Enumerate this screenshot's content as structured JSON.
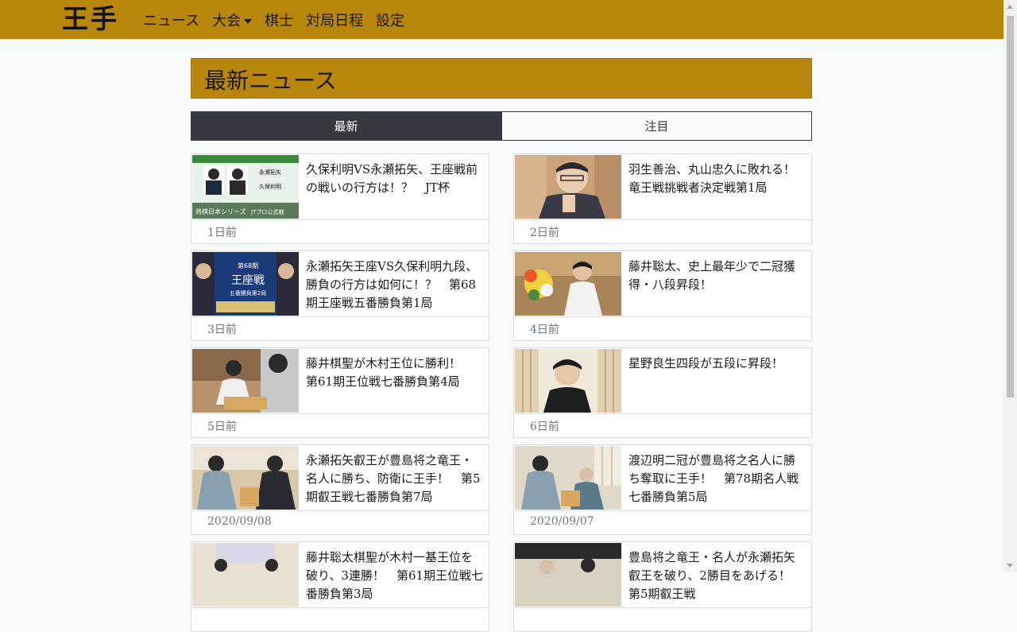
{
  "nav": {
    "logo": "王手",
    "links": [
      "ニュース",
      "大会",
      "棋士",
      "対局日程",
      "設定"
    ]
  },
  "header": {
    "title": "最新ニュース"
  },
  "tabs": [
    {
      "label": "最新",
      "active": true
    },
    {
      "label": "注目",
      "active": false
    }
  ],
  "news": [
    {
      "title": "久保利明VS永瀬拓矢、王座戦前の戦いの行方は！？　JT杯",
      "date": "1日前",
      "thumb_text": [
        "永瀬拓矢",
        "久保利明",
        "将棋日本シリーズ",
        "JTプロ公式戦"
      ]
    },
    {
      "title": "羽生善治、丸山忠久に敗れる！　竜王戦挑戦者決定戦第1局",
      "date": "2日前"
    },
    {
      "title": "永瀬拓矢王座VS久保利明九段、勝負の行方は如何に！？　第68期王座戦五番勝負第1局",
      "date": "3日前",
      "thumb_text": [
        "第68期",
        "王座戦",
        "五番勝負第2局"
      ]
    },
    {
      "title": "藤井聡太、史上最年少で二冠獲得・八段昇段！",
      "date": "4日前"
    },
    {
      "title": "藤井棋聖が木村王位に勝利！　第61期王位戦七番勝負第4局",
      "date": "5日前"
    },
    {
      "title": "星野良生四段が五段に昇段！",
      "date": "6日前"
    },
    {
      "title": "永瀬拓矢叡王が豊島将之竜王・名人に勝ち、防衛に王手！　第5期叡王戦七番勝負第7局",
      "date": "2020/09/08"
    },
    {
      "title": "渡辺明二冠が豊島将之名人に勝ち奪取に王手！　第78期名人戦七番勝負第5局",
      "date": "2020/09/07"
    },
    {
      "title": "藤井聡太棋聖が木村一基王位を破り、3連勝！　第61期王位戦七番勝負第3局",
      "date": ""
    },
    {
      "title": "豊島将之竜王・名人が永瀬拓矢叡王を破り、2勝目をあげる！　第5期叡王戦",
      "date": ""
    }
  ],
  "colors": {
    "accent": "#b8860b",
    "dark": "#343a40"
  }
}
